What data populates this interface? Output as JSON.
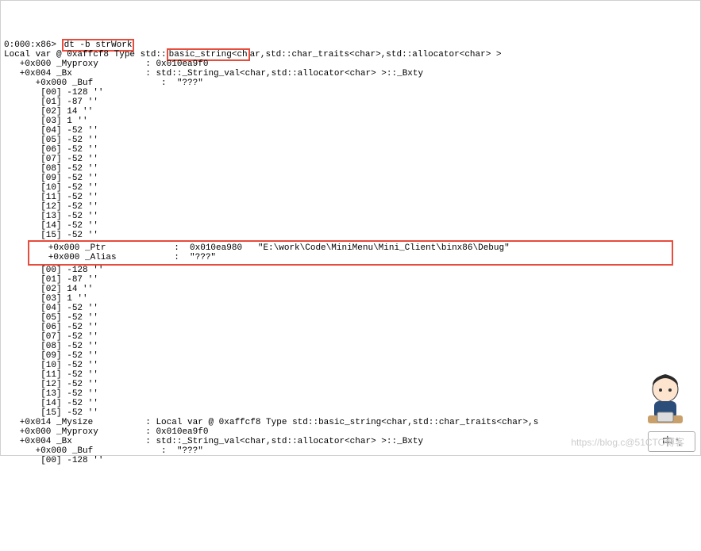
{
  "prompt": "0:000:x86> ",
  "command": "dt -b strWork",
  "line_type_prefix": "Local var @ 0xaffcf8 Type std::",
  "type_hl": "basic_string<ch",
  "type_suffix": "ar,std::char_traits<char>,std::allocator<char> >",
  "myproxy_label": "   +0x000 _Myproxy         : ",
  "myproxy_val": "0x010ea9f0",
  "bx_label": "   +0x004 _Bx              : ",
  "bx_val": "std::_String_val<char,std::allocator<char> >::_Bxty",
  "buf_label": "      +0x000 _Buf             : ",
  "buf_val": " \"???\"",
  "buf_entries": [
    "       [00] -128 ''",
    "       [01] -87 ''",
    "       [02] 14 ''",
    "       [03] 1 ''",
    "       [04] -52 ''",
    "       [05] -52 ''",
    "       [06] -52 ''",
    "       [07] -52 ''",
    "       [08] -52 ''",
    "       [09] -52 ''",
    "       [10] -52 ''",
    "       [11] -52 ''",
    "       [12] -52 ''",
    "       [13] -52 ''",
    "       [14] -52 ''",
    "       [15] -52 ''"
  ],
  "ptr_line": "   +0x000 _Ptr             :  0x010ea980   \"E:\\work\\Code\\MiniMenu\\Mini_Client\\binx86\\Debug\"",
  "alias_line": "   +0x000 _Alias           :  \"???\"",
  "alias_entries": [
    "       [00] -128 ''",
    "       [01] -87 ''",
    "       [02] 14 ''",
    "       [03] 1 ''",
    "       [04] -52 ''",
    "       [05] -52 ''",
    "       [06] -52 ''",
    "       [07] -52 ''",
    "       [08] -52 ''",
    "       [09] -52 ''",
    "       [10] -52 ''",
    "       [11] -52 ''",
    "       [12] -52 ''",
    "       [13] -52 ''",
    "       [14] -52 ''",
    "       [15] -52 ''"
  ],
  "mysize_label": "   +0x014 _Mysize          : ",
  "mysize_val": "Local var @ 0xaffcf8 Type std::basic_string<char,std::char_traits<char>,s",
  "myproxy2_label": "   +0x000 _Myproxy         : ",
  "myproxy2_val": "0x010ea9f0",
  "bx2_label": "   +0x004 _Bx              : ",
  "bx2_val": "std::_String_val<char,std::allocator<char> >::_Bxty",
  "buf2_label": "      +0x000 _Buf             : ",
  "buf2_val": " \"???\"",
  "buf2_entries": [
    "       [00] -128 ''"
  ],
  "watermark": "https://blog.c@51CTO博客",
  "badge": "中 '."
}
